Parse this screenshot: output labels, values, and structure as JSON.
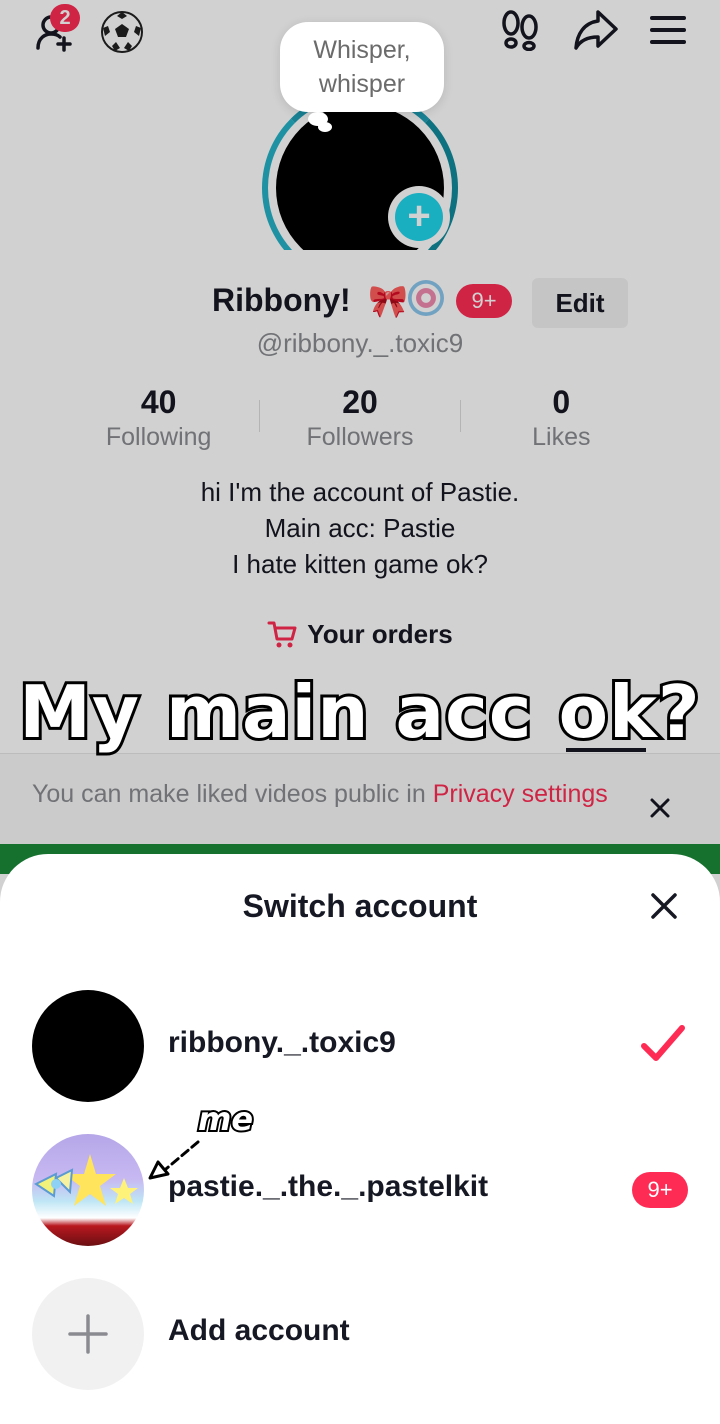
{
  "header": {
    "friend_requests_badge": "2",
    "icons": [
      "add-friend-icon",
      "soccer-ball-icon",
      "footprints-icon",
      "share-icon",
      "menu-icon"
    ]
  },
  "profile": {
    "thought_bubble": "Whisper,\nwhisper",
    "display_name": "Ribbony!",
    "name_emojis": [
      "🎀",
      "🍭"
    ],
    "notification_badge": "9+",
    "edit_label": "Edit",
    "username": "@ribbony._.toxic9",
    "stats": [
      {
        "value": "40",
        "label": "Following"
      },
      {
        "value": "20",
        "label": "Followers"
      },
      {
        "value": "0",
        "label": "Likes"
      }
    ],
    "bio_lines": [
      "hi I'm the account of Pastie.",
      "Main acc: Pastie",
      "I hate kitten game ok?"
    ],
    "orders_label": "Your orders"
  },
  "overlay_caption": "My main acc ok?",
  "annotation": "me",
  "notice": {
    "text": "You can make liked videos public in ",
    "link": "Privacy settings"
  },
  "switch_sheet": {
    "title": "Switch account",
    "accounts": [
      {
        "username": "ribbony._.toxic9",
        "selected": true
      },
      {
        "username": "pastie._.the._.pastelkit",
        "badge": "9+"
      }
    ],
    "add_label": "Add account"
  },
  "colors": {
    "accent": "#fe2c55",
    "ring": "#1f9fb5",
    "plus": "#20d5ec"
  }
}
